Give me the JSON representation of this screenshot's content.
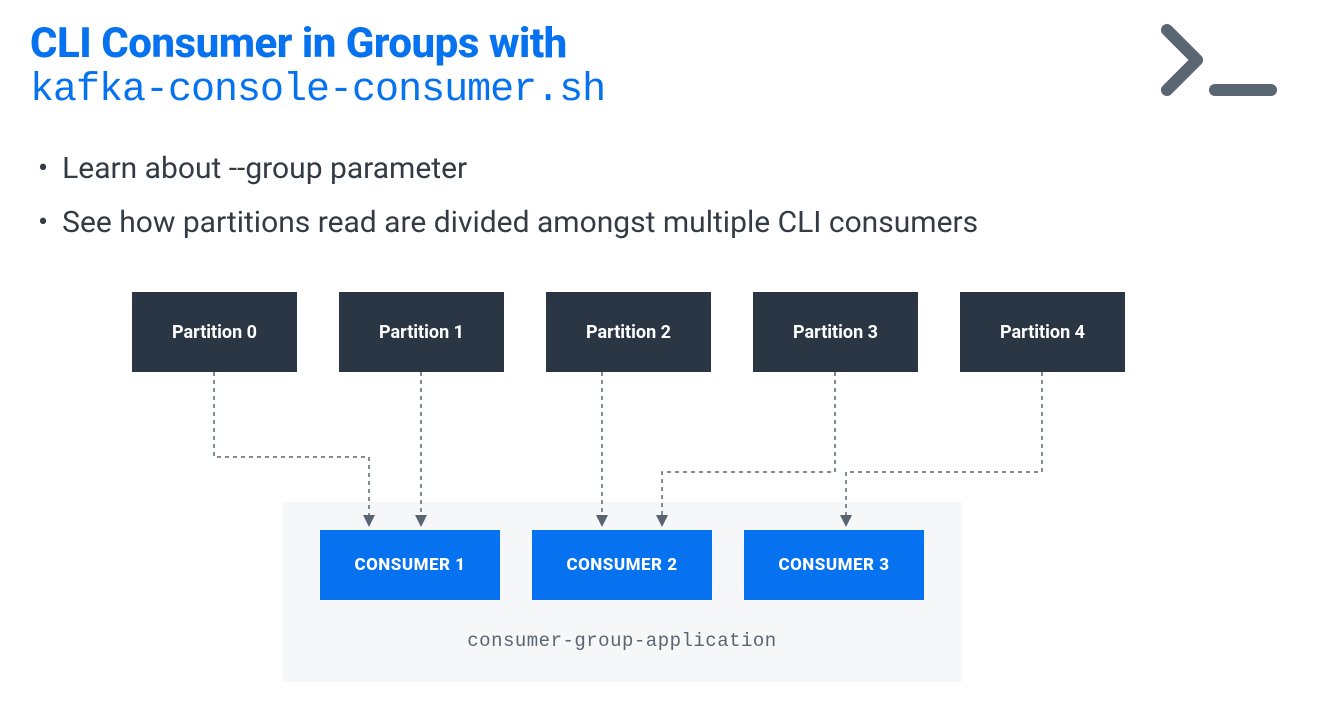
{
  "title": {
    "line1": "CLI Consumer in Groups with",
    "line2": "kafka-console-consumer.sh"
  },
  "bullets": [
    "Learn about --group parameter",
    "See how partitions read are divided amongst multiple CLI consumers"
  ],
  "partitions": [
    "Partition 0",
    "Partition 1",
    "Partition 2",
    "Partition 3",
    "Partition 4"
  ],
  "consumers": [
    "CONSUMER 1",
    "CONSUMER 2",
    "CONSUMER 3"
  ],
  "group_label": "consumer-group-application",
  "colors": {
    "accent_blue": "#0672EF",
    "dark_box": "#2b3644",
    "light_bg": "#f5f7f9",
    "text": "#333b44",
    "icon": "#5a6572"
  },
  "mapping_note": "Partitions 0,1 → Consumer 1; Partitions 2,3 → Consumer 2; Partition 4 → Consumer 3"
}
